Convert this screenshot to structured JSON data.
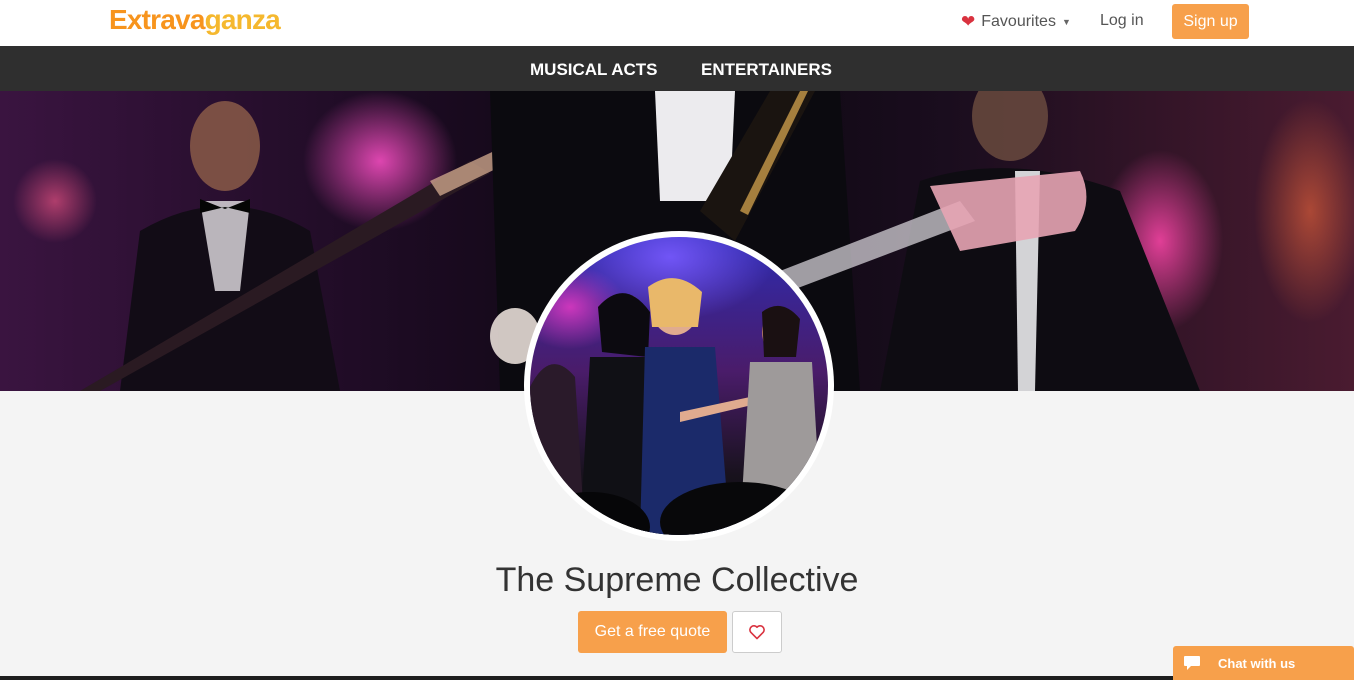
{
  "brand": {
    "logo_part1": "Extrava",
    "logo_part2": "ganza",
    "color_primary": "#f7941d",
    "color_secondary": "#f5b82e"
  },
  "header": {
    "favourites_label": "Favourites",
    "login_label": "Log in",
    "signup_label": "Sign up"
  },
  "nav": {
    "items": [
      {
        "label": "MUSICAL ACTS"
      },
      {
        "label": "ENTERTAINERS"
      }
    ]
  },
  "profile": {
    "name": "The Supreme Collective",
    "quote_button": "Get a free quote",
    "favourite_icon": "heart-outline-icon"
  },
  "chat": {
    "label": "Chat with us",
    "icon": "chat-bubble-icon"
  },
  "colors": {
    "accent": "#f7a04b",
    "nav_background": "#2f2f2f",
    "heart": "#d9323f"
  }
}
